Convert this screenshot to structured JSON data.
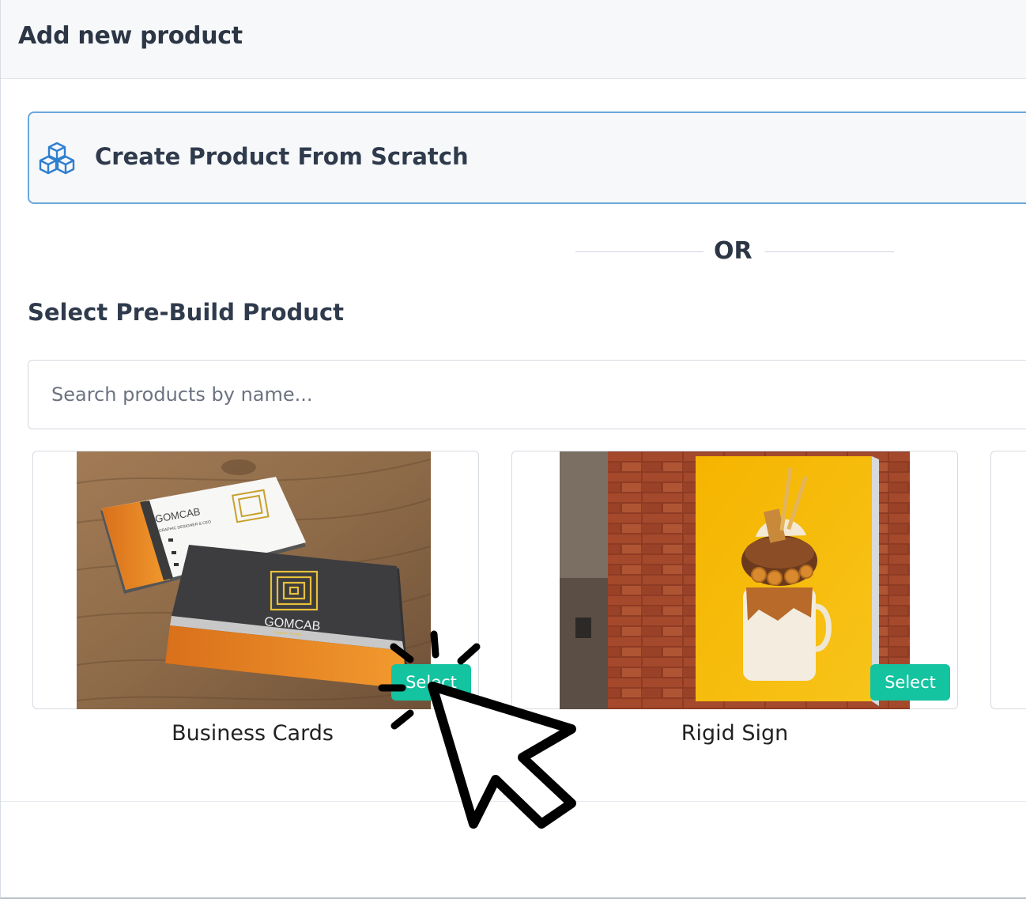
{
  "modal": {
    "title": "Add new product"
  },
  "scratch": {
    "label": "Create Product From Scratch",
    "icon": "boxes-icon"
  },
  "divider": {
    "text": "OR"
  },
  "prebuild": {
    "title": "Select Pre-Build Product"
  },
  "search": {
    "placeholder": "Search products by name...",
    "value": ""
  },
  "products": [
    {
      "name": "Business Cards",
      "select_label": "Select",
      "image": "business-cards-photo",
      "card_brand": "GOMCAB",
      "card_tagline": "GRAPHIC DESIGNER & CEO",
      "card_subtitle": "Graphic Design"
    },
    {
      "name": "Rigid Sign",
      "select_label": "Select",
      "image": "milkshake-sign-photo"
    }
  ],
  "colors": {
    "accent_border": "#6aa7dd",
    "select_button": "#14c3a0",
    "header_bg": "#f7f8fa",
    "title_text": "#2c3645"
  }
}
